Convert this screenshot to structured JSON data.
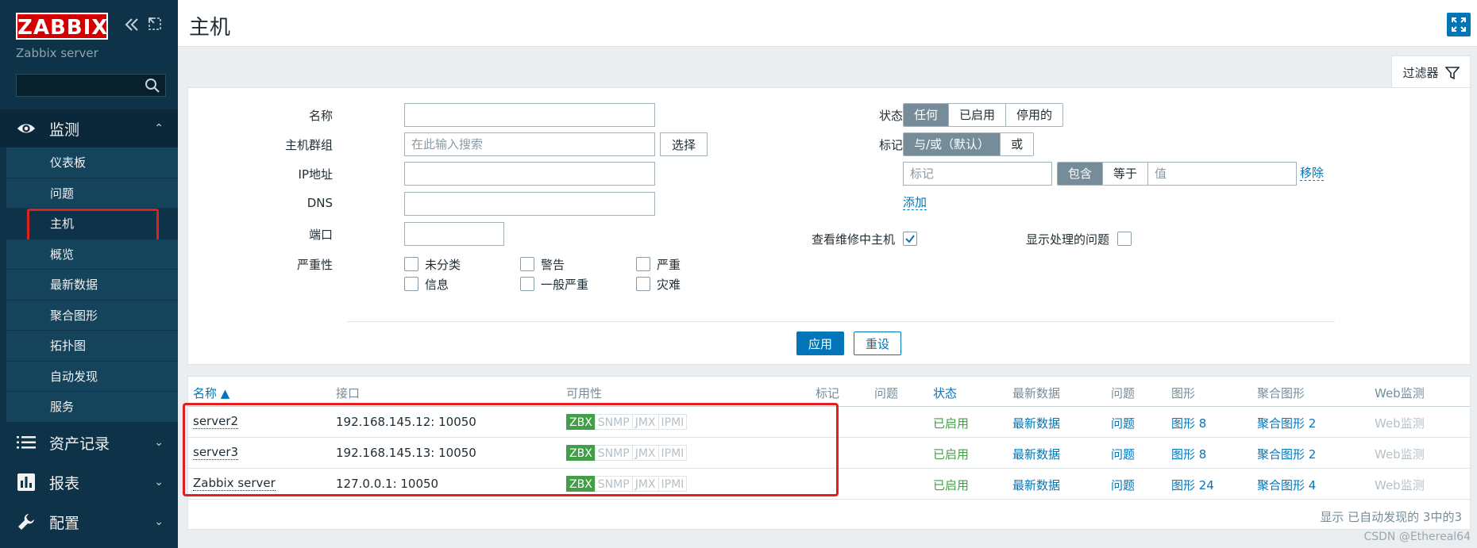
{
  "sidebar": {
    "logo": "ZABBIX",
    "collapse_icon": "double-chevron-left-icon",
    "kiosk_icon": "kiosk-icon",
    "server_name": "Zabbix server",
    "search_placeholder": "",
    "sections": [
      {
        "label": "监测",
        "icon": "eye-icon",
        "expanded": true
      },
      {
        "label": "资产记录",
        "icon": "list-icon",
        "expanded": false
      },
      {
        "label": "报表",
        "icon": "bar-chart-icon",
        "expanded": false
      },
      {
        "label": "配置",
        "icon": "wrench-icon",
        "expanded": false
      }
    ],
    "submenu": [
      "仪表板",
      "问题",
      "主机",
      "概览",
      "最新数据",
      "聚合图形",
      "拓扑图",
      "自动发现",
      "服务"
    ],
    "active_submenu": "主机"
  },
  "header": {
    "title": "主机",
    "fullscreen_icon": "fullscreen-icon"
  },
  "filter": {
    "tab_label": "过滤器",
    "name_label": "名称",
    "name_value": "",
    "group_label": "主机群组",
    "group_placeholder": "在此输入搜索",
    "select_label": "选择",
    "ip_label": "IP地址",
    "ip_value": "",
    "dns_label": "DNS",
    "dns_value": "",
    "port_label": "端口",
    "port_value": "",
    "severity_label": "严重性",
    "severities": [
      "未分类",
      "警告",
      "严重",
      "信息",
      "一般严重",
      "灾难"
    ],
    "status_label": "状态",
    "status_options": [
      "任何",
      "已启用",
      "停用的"
    ],
    "status_selected": "任何",
    "tags_label": "标记",
    "tag_mode_options": [
      "与/或（默认）",
      "或"
    ],
    "tag_mode_selected": "与/或（默认）",
    "tag_placeholder": "标记",
    "tag_op_options": [
      "包含",
      "等于"
    ],
    "tag_op_selected": "包含",
    "value_placeholder": "值",
    "remove_label": "移除",
    "add_label": "添加",
    "maintenance_label": "查看维修中主机",
    "maintenance_checked": true,
    "suppressed_label": "显示处理的问题",
    "suppressed_checked": false,
    "apply_label": "应用",
    "reset_label": "重设"
  },
  "table": {
    "columns": [
      "名称 ▲",
      "接口",
      "可用性",
      "标记",
      "问题",
      "状态",
      "最新数据",
      "问题",
      "图形",
      "聚合图形",
      "Web监测"
    ],
    "rows": [
      {
        "name": "server2",
        "interface": "192.168.145.12: 10050",
        "status": "已启用",
        "latest": "最新数据",
        "problems": "问题",
        "graphs": "图形 8",
        "screens": "聚合图形 2",
        "web": "Web监测"
      },
      {
        "name": "server3",
        "interface": "192.168.145.13: 10050",
        "status": "已启用",
        "latest": "最新数据",
        "problems": "问题",
        "graphs": "图形 8",
        "screens": "聚合图形 2",
        "web": "Web监测"
      },
      {
        "name": "Zabbix server",
        "interface": "127.0.0.1: 10050",
        "status": "已启用",
        "latest": "最新数据",
        "problems": "问题",
        "graphs": "图形 24",
        "screens": "聚合图形 4",
        "web": "Web监测"
      }
    ],
    "availability": [
      "ZBX",
      "SNMP",
      "JMX",
      "IPMI"
    ],
    "footer": "显示 已自动发现的 3中的3"
  },
  "watermark": "CSDN @Ethereal64",
  "colors": {
    "sidebar": "#0e3349",
    "accent": "#0275b8",
    "ok": "#429e47",
    "highlight": "#e02020"
  }
}
